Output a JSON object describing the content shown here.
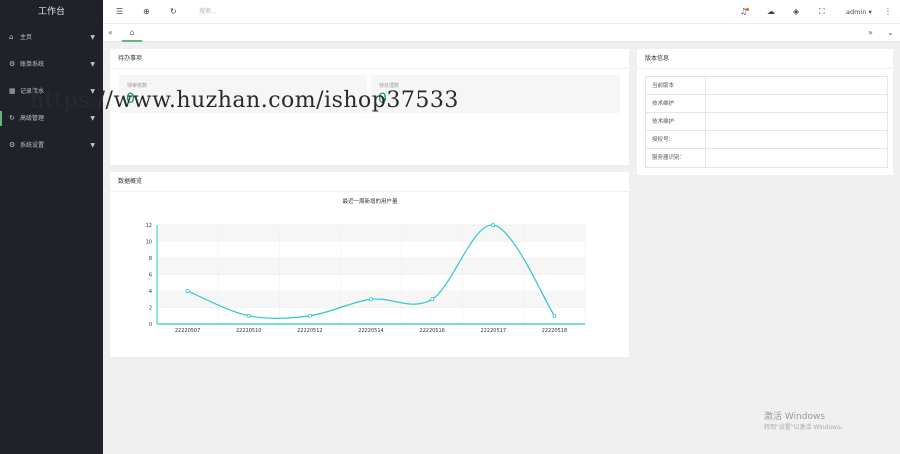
{
  "sidebar": {
    "title": "工作台",
    "items": [
      {
        "icon": "home-icon",
        "glyph": "⌂",
        "label": "主页"
      },
      {
        "icon": "gear-icon",
        "glyph": "⚙",
        "label": "账单系统"
      },
      {
        "icon": "grid-icon",
        "glyph": "▦",
        "label": "记录流水"
      },
      {
        "icon": "refresh-icon",
        "glyph": "↻",
        "label": "高级管理"
      },
      {
        "icon": "gear-icon",
        "glyph": "⚙",
        "label": "系统设置"
      }
    ]
  },
  "header": {
    "search_placeholder": "搜索...",
    "user": "admin"
  },
  "todo": {
    "title": "待办事项",
    "stats": [
      {
        "label": "待审核数",
        "value": "0"
      },
      {
        "label": "待处理数",
        "value": "0"
      }
    ]
  },
  "version": {
    "title": "版本信息",
    "rows": [
      {
        "label": "当前版本",
        "value": ""
      },
      {
        "label": "技术维护",
        "value": ""
      },
      {
        "label": "技术维护",
        "value": ""
      },
      {
        "label": "授权号：",
        "value": ""
      },
      {
        "label": "服务器识别：",
        "value": ""
      }
    ]
  },
  "overview": {
    "title": "数据概览"
  },
  "chart_data": {
    "type": "line",
    "title": "最近一周新增的用户量",
    "categories": [
      "22220507",
      "22220510",
      "22220512",
      "22220514",
      "22220516",
      "22220517",
      "22220518"
    ],
    "series": [
      {
        "values": [
          4,
          1,
          1,
          3,
          3,
          12,
          1
        ]
      }
    ],
    "ylim": [
      0,
      12
    ],
    "yticks": [
      0,
      2,
      4,
      6,
      8,
      10,
      12
    ],
    "color": "#2ec7c9",
    "smooth": true,
    "grid": true
  },
  "watermark": "https://www.huzhan.com/ishop37533",
  "activation": {
    "line1": "激活 Windows",
    "line2": "转到\"设置\"以激活 Windows。"
  }
}
